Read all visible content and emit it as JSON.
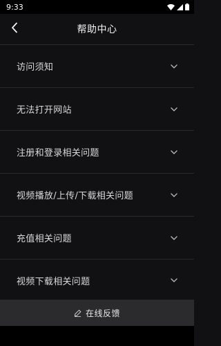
{
  "status": {
    "time": "9:33"
  },
  "header": {
    "title": "帮助中心"
  },
  "faq": {
    "items": [
      {
        "label": "访问须知"
      },
      {
        "label": "无法打开网站"
      },
      {
        "label": "注册和登录相关问题"
      },
      {
        "label": "视频播放/上传/下载相关问题"
      },
      {
        "label": "充值相关问题"
      },
      {
        "label": "视频下载相关问题"
      }
    ]
  },
  "footer": {
    "feedback_label": "在线反馈"
  },
  "icons": {
    "back": "chevron-left-icon",
    "expand": "chevron-down-icon",
    "feedback": "edit-icon",
    "wifi": "wifi-icon",
    "signal": "signal-icon",
    "battery": "battery-icon"
  },
  "colors": {
    "background": "#111113",
    "divider": "#2a2a2d",
    "feedback_bar": "#2b2b2e",
    "text": "#d9d9d9"
  }
}
